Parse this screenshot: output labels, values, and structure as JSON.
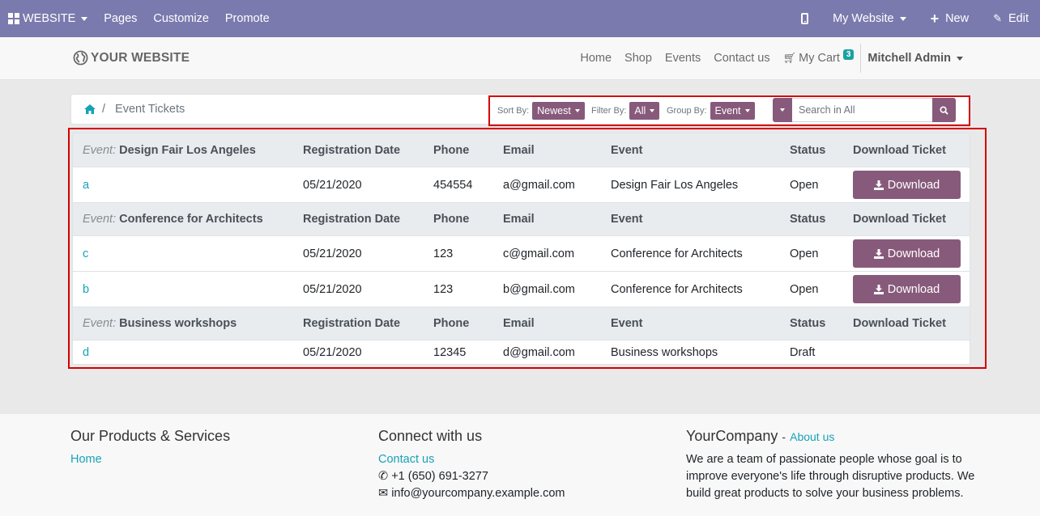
{
  "adminbar": {
    "website_menu": "WEBSITE",
    "items": [
      "Pages",
      "Customize",
      "Promote"
    ],
    "my_website": "My Website",
    "new_label": "New",
    "edit_label": "Edit"
  },
  "header": {
    "logo_text": "YOUR WEBSITE",
    "nav": [
      "Home",
      "Shop",
      "Events",
      "Contact us"
    ],
    "cart_label": "My Cart",
    "cart_count": "3",
    "user_name": "Mitchell Admin"
  },
  "breadcrumb": {
    "current": "Event Tickets",
    "separator": "/"
  },
  "filters": {
    "sort_label": "Sort By:",
    "sort_value": "Newest",
    "filter_label": "Filter By:",
    "filter_value": "All",
    "group_label": "Group By:",
    "group_value": "Event",
    "search_placeholder": "Search in All"
  },
  "table": {
    "event_prefix": "Event:",
    "columns": [
      "Registration Date",
      "Phone",
      "Email",
      "Event",
      "Status",
      "Download Ticket"
    ],
    "download_label": "Download",
    "groups": [
      {
        "event": "Design Fair Los Angeles",
        "rows": [
          {
            "name": "a",
            "date": "05/21/2020",
            "phone": "454554",
            "email": "a@gmail.com",
            "event": "Design Fair Los Angeles",
            "status": "Open",
            "downloadable": true
          }
        ]
      },
      {
        "event": "Conference for Architects",
        "rows": [
          {
            "name": "c",
            "date": "05/21/2020",
            "phone": "123",
            "email": "c@gmail.com",
            "event": "Conference for Architects",
            "status": "Open",
            "downloadable": true
          },
          {
            "name": "b",
            "date": "05/21/2020",
            "phone": "123",
            "email": "b@gmail.com",
            "event": "Conference for Architects",
            "status": "Open",
            "downloadable": true
          }
        ]
      },
      {
        "event": "Business workshops",
        "rows": [
          {
            "name": "d",
            "date": "05/21/2020",
            "phone": "12345",
            "email": "d@gmail.com",
            "event": "Business workshops",
            "status": "Draft",
            "downloadable": false
          }
        ]
      }
    ]
  },
  "footer": {
    "products_title": "Our Products & Services",
    "products_link": "Home",
    "connect_title": "Connect with us",
    "contact_link": "Contact us",
    "phone": "+1 (650) 691-3277",
    "email": "info@yourcompany.example.com",
    "company_title": "YourCompany",
    "company_dash": "-",
    "about_link": "About us",
    "company_text_1": "We are a team of passionate people whose goal is to",
    "company_text_2": "improve everyone's life through disruptive products. We",
    "company_text_3": "build great products to solve your business problems."
  }
}
